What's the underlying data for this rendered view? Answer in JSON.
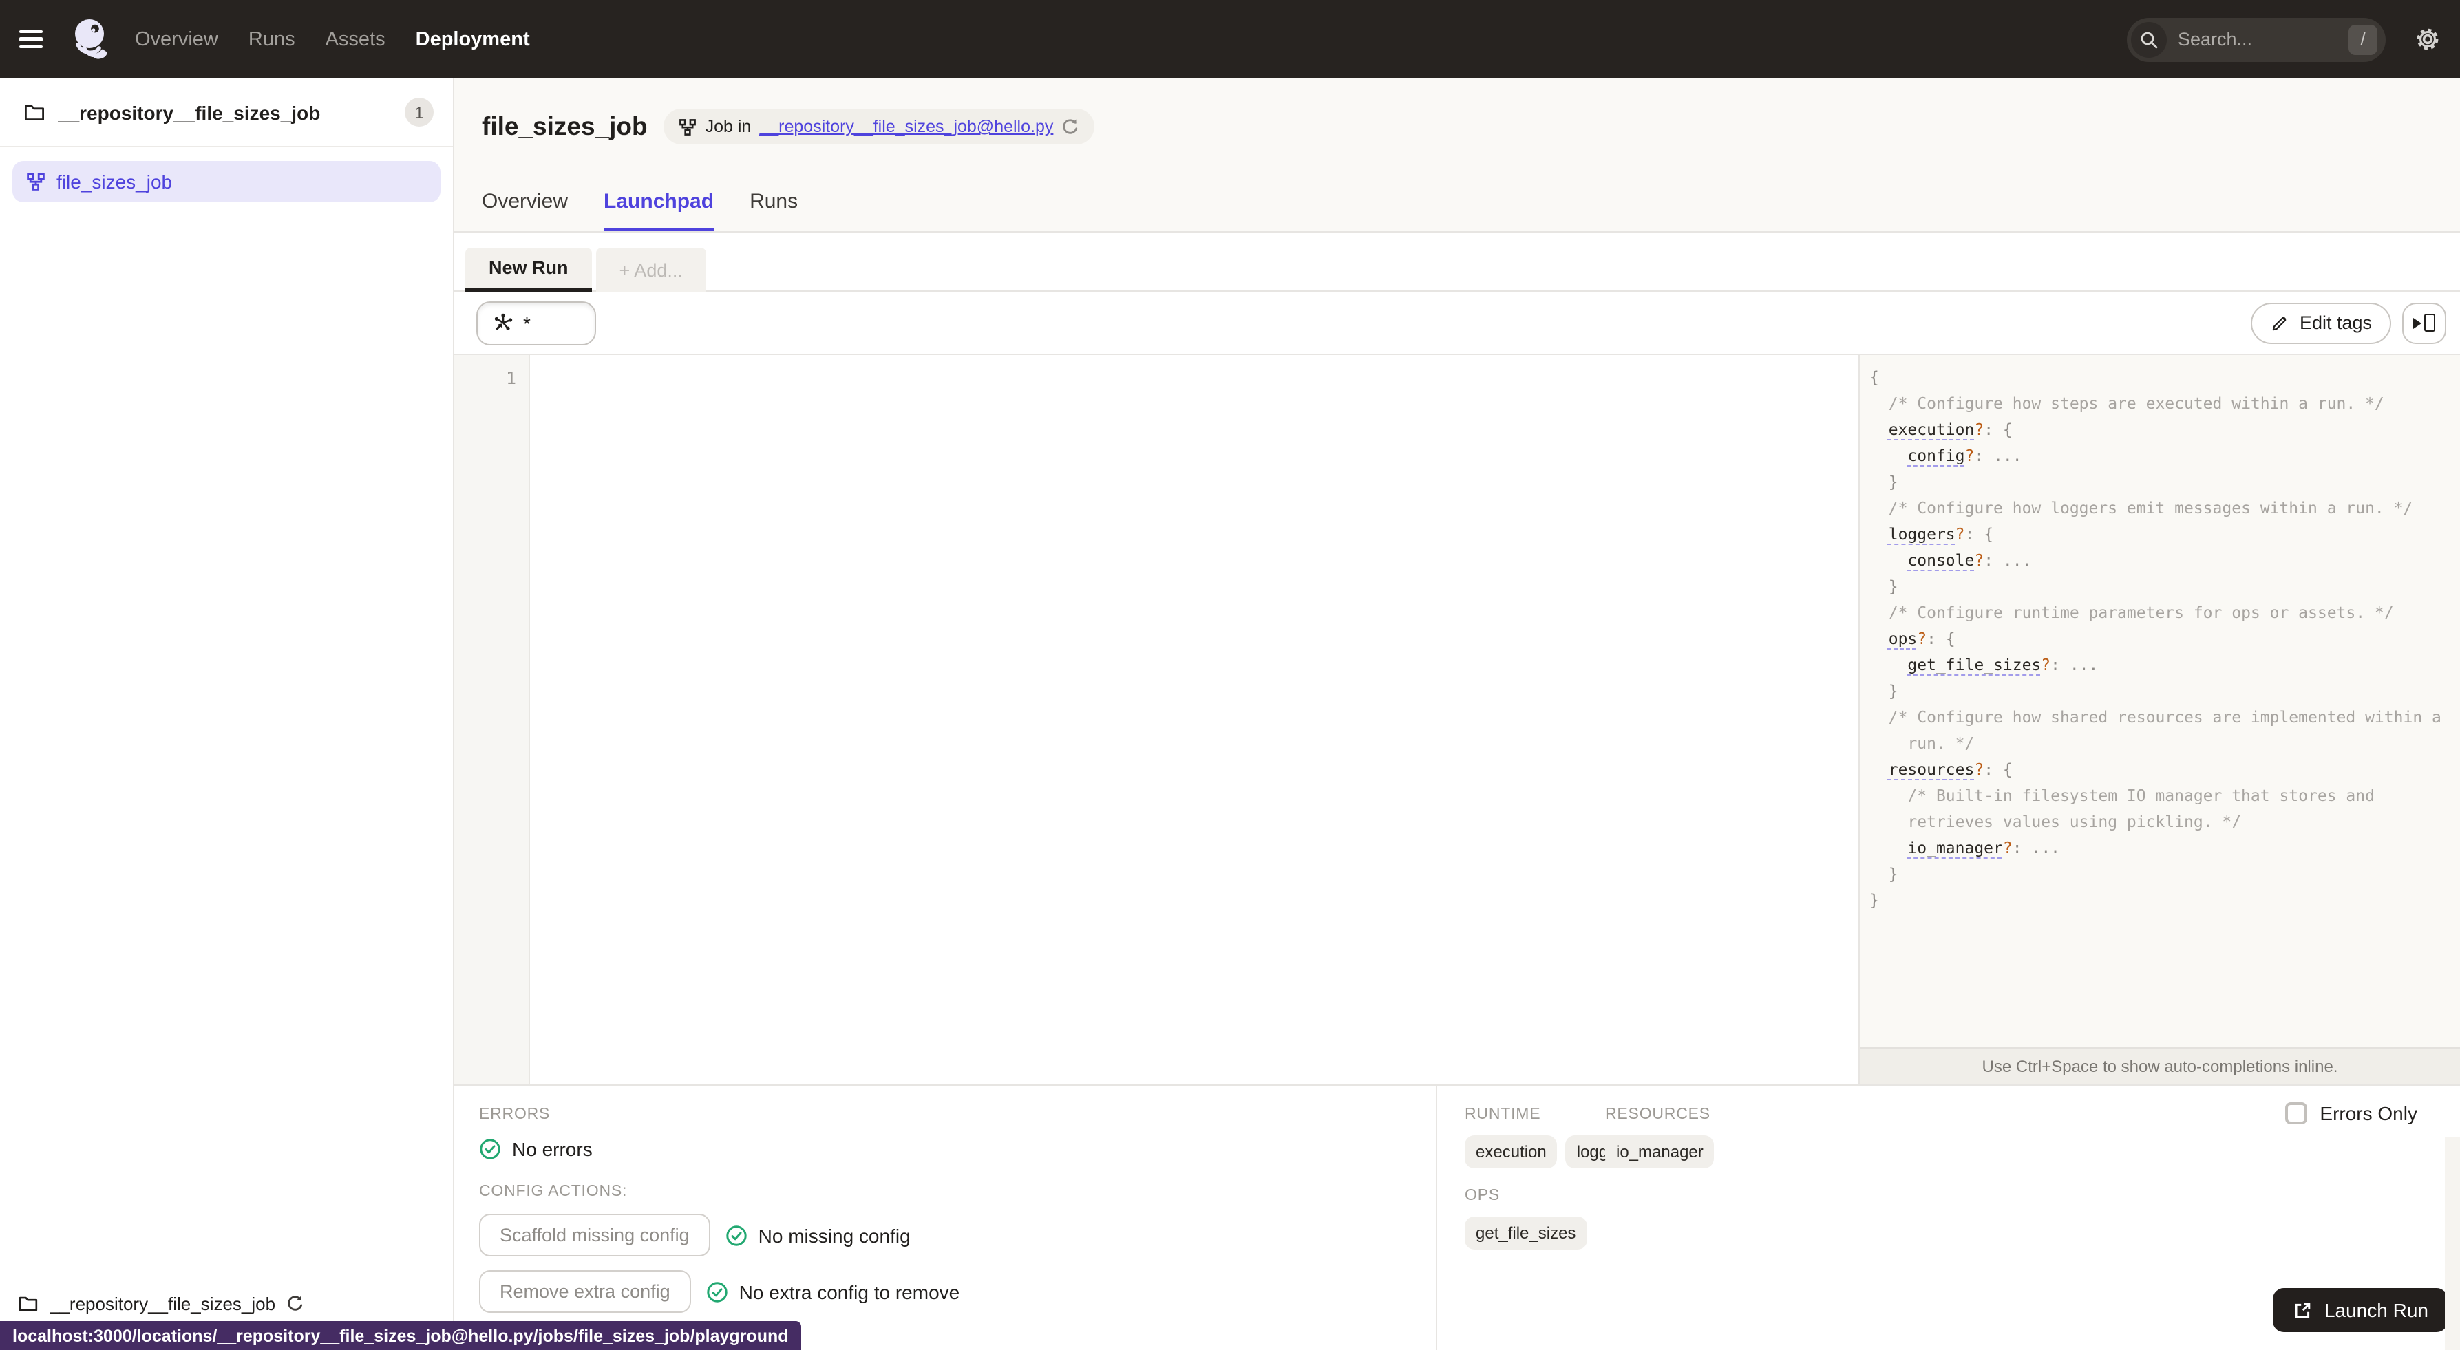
{
  "nav": {
    "links": [
      "Overview",
      "Runs",
      "Assets",
      "Deployment"
    ],
    "active_link": "Deployment",
    "search": {
      "placeholder": "Search...",
      "shortcut": "/"
    }
  },
  "sidebar": {
    "repo_group": {
      "name": "__repository__file_sizes_job",
      "badge_count": "1"
    },
    "jobs": [
      {
        "name": "file_sizes_job"
      }
    ],
    "footer_repo": "__repository__file_sizes_job"
  },
  "header": {
    "title": "file_sizes_job",
    "job_context": {
      "prefix": "Job in ",
      "link": "__repository__file_sizes_job@hello.py"
    },
    "tabs": [
      "Overview",
      "Launchpad",
      "Runs"
    ],
    "active_tab": "Launchpad"
  },
  "launchpad": {
    "config_tab": "New Run",
    "add_tab": "+ Add...",
    "op_selector": "*",
    "edit_tags": "Edit tags",
    "editor": {
      "line_number": "1",
      "content": ""
    },
    "schema": {
      "hint": "Use Ctrl+Space to show auto-completions inline.",
      "lines": [
        [
          {
            "t": "{",
            "c": "p"
          }
        ],
        [
          {
            "t": "  ",
            "c": "w"
          },
          {
            "t": "/* Configure how steps are executed within a run. */",
            "c": "cm"
          }
        ],
        [
          {
            "t": "  ",
            "c": "w"
          },
          {
            "t": "execution",
            "c": "k"
          },
          {
            "t": "?",
            "c": "q"
          },
          {
            "t": ": {",
            "c": "p"
          }
        ],
        [
          {
            "t": "    ",
            "c": "w"
          },
          {
            "t": "config",
            "c": "k"
          },
          {
            "t": "?",
            "c": "q"
          },
          {
            "t": ": ...",
            "c": "p"
          }
        ],
        [
          {
            "t": "  }",
            "c": "p"
          }
        ],
        [
          {
            "t": "  ",
            "c": "w"
          },
          {
            "t": "/* Configure how loggers emit messages within a run. */",
            "c": "cm"
          }
        ],
        [
          {
            "t": "  ",
            "c": "w"
          },
          {
            "t": "loggers",
            "c": "k"
          },
          {
            "t": "?",
            "c": "q"
          },
          {
            "t": ": {",
            "c": "p"
          }
        ],
        [
          {
            "t": "    ",
            "c": "w"
          },
          {
            "t": "console",
            "c": "k"
          },
          {
            "t": "?",
            "c": "q"
          },
          {
            "t": ": ...",
            "c": "p"
          }
        ],
        [
          {
            "t": "  }",
            "c": "p"
          }
        ],
        [
          {
            "t": "  ",
            "c": "w"
          },
          {
            "t": "/* Configure runtime parameters for ops or assets. */",
            "c": "cm"
          }
        ],
        [
          {
            "t": "  ",
            "c": "w"
          },
          {
            "t": "ops",
            "c": "k"
          },
          {
            "t": "?",
            "c": "q"
          },
          {
            "t": ": {",
            "c": "p"
          }
        ],
        [
          {
            "t": "    ",
            "c": "w"
          },
          {
            "t": "get_file_sizes",
            "c": "k"
          },
          {
            "t": "?",
            "c": "q"
          },
          {
            "t": ": ...",
            "c": "p"
          }
        ],
        [
          {
            "t": "  }",
            "c": "p"
          }
        ],
        [
          {
            "t": "  ",
            "c": "w"
          },
          {
            "t": "/* Configure how shared resources are implemented within a",
            "c": "cm"
          }
        ],
        [
          {
            "t": "    ",
            "c": "w"
          },
          {
            "t": "run. */",
            "c": "cm"
          }
        ],
        [
          {
            "t": "  ",
            "c": "w"
          },
          {
            "t": "resources",
            "c": "k"
          },
          {
            "t": "?",
            "c": "q"
          },
          {
            "t": ": {",
            "c": "p"
          }
        ],
        [
          {
            "t": "    ",
            "c": "w"
          },
          {
            "t": "/* Built-in filesystem IO manager that stores and",
            "c": "cm"
          }
        ],
        [
          {
            "t": "    ",
            "c": "w"
          },
          {
            "t": "retrieves values using pickling. */",
            "c": "cm"
          }
        ],
        [
          {
            "t": "    ",
            "c": "w"
          },
          {
            "t": "io_manager",
            "c": "k"
          },
          {
            "t": "?",
            "c": "q"
          },
          {
            "t": ": ...",
            "c": "p"
          }
        ],
        [
          {
            "t": "  }",
            "c": "p"
          }
        ],
        [
          {
            "t": "}",
            "c": "p"
          }
        ]
      ]
    }
  },
  "footer_panel": {
    "errors": {
      "label": "ERRORS",
      "status": "No errors"
    },
    "config_actions": {
      "label": "CONFIG ACTIONS:",
      "actions": [
        {
          "button": "Scaffold missing config",
          "status": "No missing config"
        },
        {
          "button": "Remove extra config",
          "status": "No extra config to remove"
        }
      ]
    },
    "runtime": {
      "label": "RUNTIME",
      "tags": [
        "execution",
        "loggers"
      ]
    },
    "resources": {
      "label": "RESOURCES",
      "tags": [
        "io_manager"
      ]
    },
    "ops": {
      "label": "OPS",
      "tags": [
        "get_file_sizes"
      ]
    },
    "errors_only": "Errors Only",
    "launch_run": "Launch Run"
  },
  "status_bar": {
    "url": "localhost:3000/locations/__repository__file_sizes_job@hello.py/jobs/file_sizes_job/playground"
  },
  "colors": {
    "accent": "#4F43DD",
    "success_green": "#22A871",
    "nav_bg": "#272320",
    "status_bar_bg": "#452C63",
    "optional_marker": "#BC5E17"
  }
}
